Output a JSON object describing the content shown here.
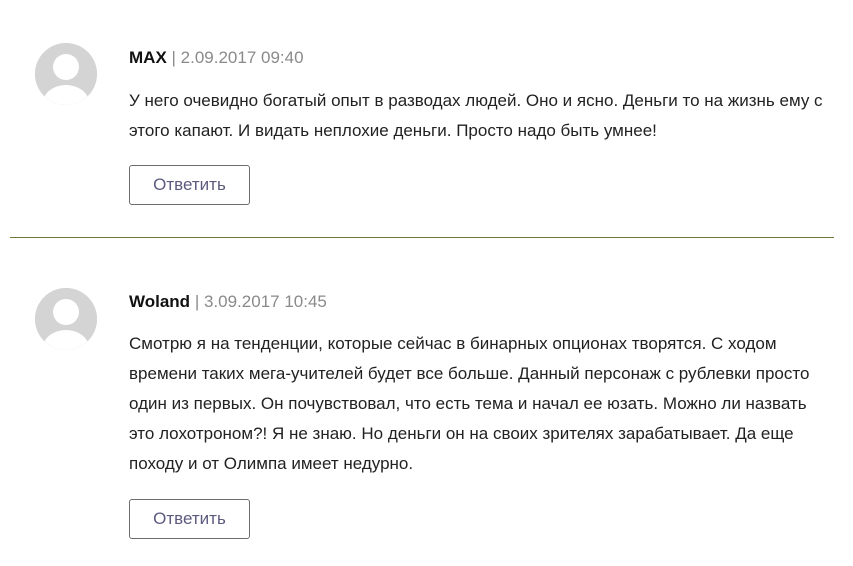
{
  "colors": {
    "divider": "#6b7a3c",
    "reply_text": "#5c5a7e",
    "meta_gray": "#8a8a8a",
    "avatar_bg": "#d4d4d4"
  },
  "comments": [
    {
      "avatar_icon": "default-user-icon",
      "author": "MAX",
      "separator": "|",
      "date": "2.09.2017 09:40",
      "text": "У него очевидно богатый опыт в разводах людей. Оно и ясно. Деньги то на жизнь ему с этого капают. И видать неплохие деньги. Просто надо быть умнее!",
      "reply_label": "Ответить"
    },
    {
      "avatar_icon": "default-user-icon",
      "author": "Woland",
      "separator": "|",
      "date": "3.09.2017 10:45",
      "text": "Смотрю я на тенденции, которые сейчас в бинарных опционах творятся. С ходом времени таких мега-учителей будет все больше. Данный персонаж с рублевки просто один из первых. Он почувствовал, что есть тема и начал ее юзать. Можно ли назвать это лохотроном?! Я не знаю. Но деньги он на своих зрителях зарабатывает. Да еще походу и от Олимпа имеет недурно.",
      "reply_label": "Ответить"
    }
  ]
}
